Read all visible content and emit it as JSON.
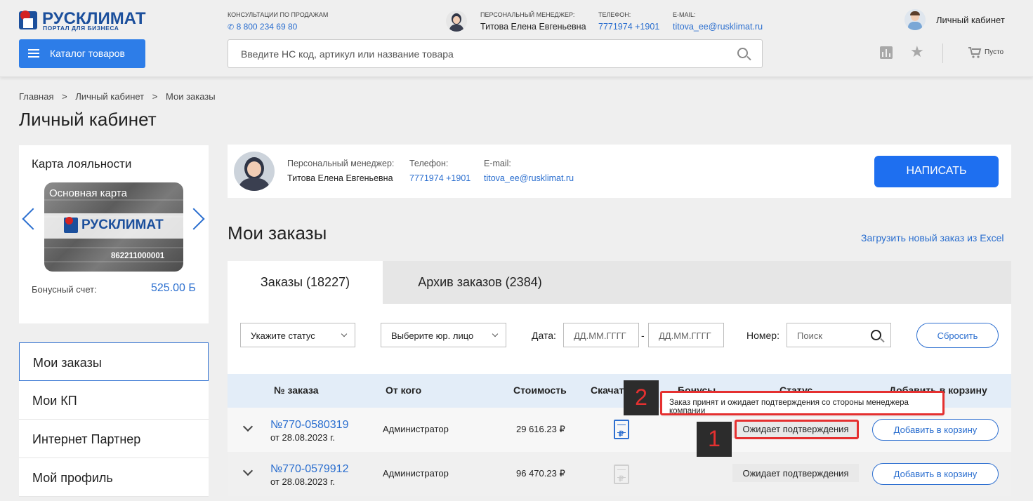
{
  "header": {
    "logo_name": "РУСКЛИМАТ",
    "logo_sub": "ПОРТАЛ ДЛЯ БИЗНЕСА",
    "sales_caption": "КОНСУЛЬТАЦИИ ПО ПРОДАЖАМ",
    "sales_phone": "8 800 234 69 80",
    "manager_caption": "ПЕРСОНАЛЬНЫЙ МЕНЕДЖЕР:",
    "manager_name": "Титова Елена Евгеньевна",
    "phone_caption": "ТЕЛЕФОН:",
    "phone": "7771974 +1901",
    "email_caption": "E-MAIL:",
    "email": "titova_ee@rusklimat.ru",
    "account_label": "Личный кабинет",
    "catalog_label": "Каталог товаров",
    "search_placeholder": "Введите НС код, артикул или название товара",
    "cart_label": "Пусто"
  },
  "breadcrumb": {
    "items": [
      "Главная",
      "Личный кабинет",
      "Мои заказы"
    ],
    "sep": ">"
  },
  "page_title": "Личный кабинет",
  "loyalty": {
    "title": "Карта лояльности",
    "card_title": "Основная карта",
    "card_brand": "РУСКЛИМАТ",
    "card_number": "862211000001",
    "bonus_label": "Бонусный счет:",
    "bonus_value": "525.00 Б"
  },
  "sidebar": {
    "items": [
      {
        "label": "Мои заказы"
      },
      {
        "label": "Мои КП"
      },
      {
        "label": "Интернет Партнер"
      },
      {
        "label": "Мой профиль"
      }
    ]
  },
  "manager_card": {
    "caption": "Персональный менеджер:",
    "name": "Титова Елена Евгеньевна",
    "phone_caption": "Телефон:",
    "phone": "7771974 +1901",
    "email_caption": "E-mail:",
    "email": "titova_ee@rusklimat.ru",
    "write_button": "НАПИСАТЬ"
  },
  "orders": {
    "title": "Мои заказы",
    "upload_link": "Загрузить новый заказ из Excel",
    "tabs": [
      {
        "label": "Заказы (18227)"
      },
      {
        "label": "Архив заказов (2384)"
      }
    ],
    "filters": {
      "status_placeholder": "Укажите статус",
      "entity_placeholder": "Выберите юр. лицо",
      "date_label": "Дата:",
      "date_from": "ДД.ММ.ГГГГ",
      "date_sep": "-",
      "date_to": "ДД.ММ.ГГГГ",
      "number_label": "Номер:",
      "number_placeholder": "Поиск",
      "reset_button": "Сбросить"
    },
    "columns": {
      "number": "№ заказа",
      "from": "От кого",
      "cost": "Стоимость",
      "download": "Скачать счет",
      "bonus": "Бонусы",
      "status": "Статус",
      "add_to_cart": "Добавить в корзину"
    },
    "rows": [
      {
        "number": "№770-0580319",
        "date": "от 28.08.2023 г.",
        "from": "Администратор",
        "cost": "29 616.23 ₽",
        "status": "Ожидает подтверждения",
        "add": "Добавить в корзину"
      },
      {
        "number": "№770-0579912",
        "date": "от 28.08.2023 г.",
        "from": "Администратор",
        "cost": "96 470.23 ₽",
        "status": "Ожидает подтверждения",
        "add": "Добавить в корзину"
      }
    ],
    "tooltip": "Заказ принят и ожидает подтверждения со стороны менеджера компании"
  },
  "annotations": {
    "marker_1": "1",
    "marker_2": "2"
  },
  "colors": {
    "accent": "#1e6ff0",
    "link": "#2a6ecf",
    "annotation_red": "#e53030"
  }
}
